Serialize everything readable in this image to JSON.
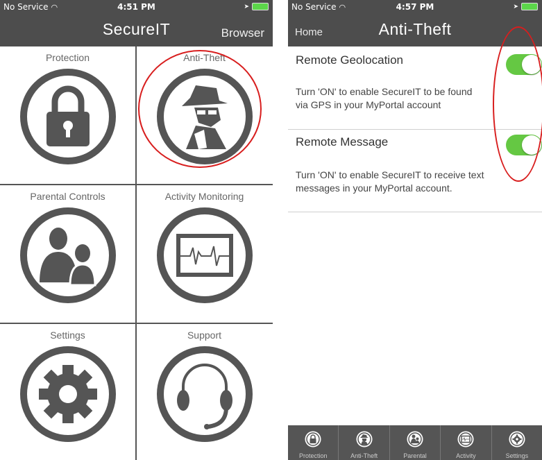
{
  "left": {
    "status": {
      "carrier": "No Service",
      "time": "4:51 PM"
    },
    "nav": {
      "title": "SecureIT",
      "right_button": "Browser"
    },
    "tiles": [
      {
        "label": "Protection",
        "icon": "lock-icon"
      },
      {
        "label": "Anti-Theft",
        "icon": "spy-icon"
      },
      {
        "label": "Parental Controls",
        "icon": "family-icon"
      },
      {
        "label": "Activity Monitoring",
        "icon": "heartbeat-monitor-icon"
      },
      {
        "label": "Settings",
        "icon": "gear-icon"
      },
      {
        "label": "Support",
        "icon": "headset-icon"
      }
    ]
  },
  "right": {
    "status": {
      "carrier": "No Service",
      "time": "4:57 PM"
    },
    "nav": {
      "title": "Anti-Theft",
      "left_button": "Home"
    },
    "settings": [
      {
        "title": "Remote Geolocation",
        "desc_line1": "Turn 'ON' to enable SecureIT to be found",
        "desc_line2": "via GPS in your MyPortal account",
        "enabled": true
      },
      {
        "title": "Remote Message",
        "desc_line1": "Turn 'ON' to enable SecureIT to receive text",
        "desc_line2": "messages in your MyPortal account.",
        "enabled": true
      }
    ],
    "tabs": [
      {
        "label": "Protection",
        "icon": "lock-icon"
      },
      {
        "label": "Anti-Theft",
        "icon": "spy-icon"
      },
      {
        "label": "Parental",
        "icon": "family-icon"
      },
      {
        "label": "Activity",
        "icon": "heartbeat-monitor-icon"
      },
      {
        "label": "Settings",
        "icon": "gear-icon"
      }
    ]
  },
  "colors": {
    "bar": "#4d4d4d",
    "toggle_on": "#65c843",
    "highlight": "#d81e1e",
    "icon": "#555555"
  }
}
